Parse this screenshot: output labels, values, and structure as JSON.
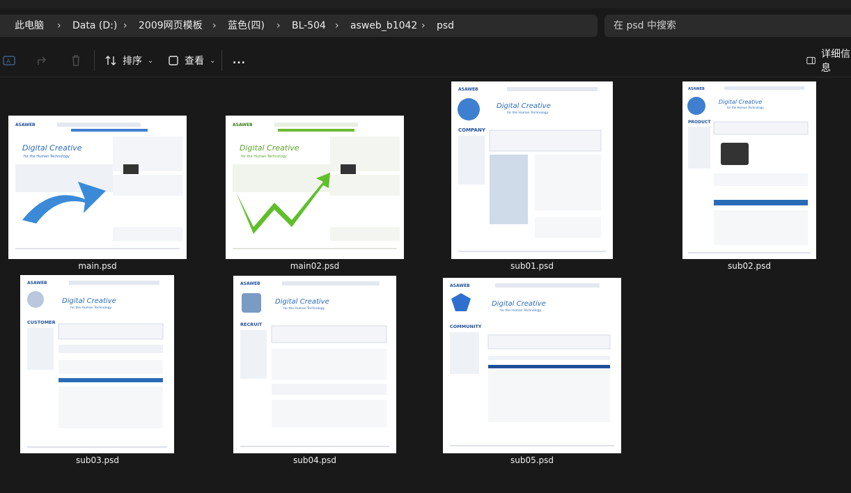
{
  "address": {
    "segments": [
      "此电脑",
      "Data (D:)",
      "2009网页模板",
      "蓝色(四)",
      "BL-504",
      "asweb_b1042",
      "psd"
    ]
  },
  "search": {
    "placeholder": "在 psd 中搜索"
  },
  "toolbar": {
    "sort_label": "排序",
    "view_label": "查看",
    "more_label": "...",
    "details_label": "详细信息"
  },
  "files": [
    {
      "name": "main.psd",
      "brand": "ASAWEB",
      "headline": "Digital Creative",
      "sub": "for the Human Technology"
    },
    {
      "name": "main02.psd",
      "brand": "ASAWEB",
      "headline": "Digital Creative",
      "sub": "for the Human Technology"
    },
    {
      "name": "sub01.psd",
      "brand": "ASAWEB",
      "headline": "Digital Creative",
      "sub": "for the Human Technology",
      "section": "COMPANY"
    },
    {
      "name": "sub02.psd",
      "brand": "ASAWEB",
      "headline": "Digital Creative",
      "sub": "for the Human Technology",
      "section": "PRODUCT"
    },
    {
      "name": "sub03.psd",
      "brand": "ASAWEB",
      "headline": "Digital Creative",
      "sub": "for the Human Technology",
      "section": "CUSTOMER"
    },
    {
      "name": "sub04.psd",
      "brand": "ASAWEB",
      "headline": "Digital Creative",
      "sub": "for the Human Technology",
      "section": "RECRUIT"
    },
    {
      "name": "sub05.psd",
      "brand": "ASAWEB",
      "headline": "Digital Creative",
      "sub": "for the Human Technology",
      "section": "COMMUNITY"
    }
  ],
  "colors": {
    "background": "#191919",
    "bar": "#2b2b2b",
    "accent_blue": "#1f5fb0",
    "accent_green": "#5aa52a"
  }
}
